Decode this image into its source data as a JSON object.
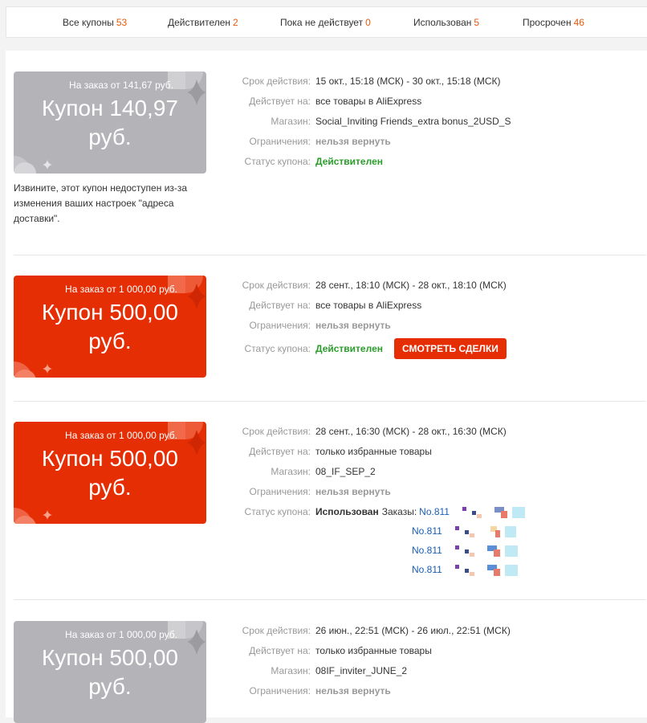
{
  "tabs": [
    {
      "label": "Все купоны",
      "count": "53"
    },
    {
      "label": "Действителен",
      "count": "2"
    },
    {
      "label": "Пока не действует",
      "count": "0"
    },
    {
      "label": "Использован",
      "count": "5"
    },
    {
      "label": "Просрочен",
      "count": "46"
    }
  ],
  "labels": {
    "period": "Срок действия:",
    "applies": "Действует на:",
    "store": "Магазин:",
    "limits": "Ограничения:",
    "status": "Статус купона:",
    "orders": "Заказы:"
  },
  "coupons": [
    {
      "style": "gray",
      "min_order": "На заказ от 141,67 руб.",
      "amount_line1": "Купон 140,97",
      "amount_line2": "руб.",
      "period": "15 окт., 15:18 (МСК) - 30 окт., 15:18 (МСК)",
      "applies": "все товары в AliExpress",
      "store": "Social_Inviting Friends_extra bonus_2USD_S",
      "limits": "нельзя вернуть",
      "status": "Действителен",
      "note": "Извините, этот купон недоступен из-за изменения ваших настроек \"адреса доставки\"."
    },
    {
      "style": "red",
      "min_order": "На заказ от 1 000,00 руб.",
      "amount_line1": "Купон 500,00",
      "amount_line2": "руб.",
      "period": "28 сент., 18:10 (МСК) - 28 окт., 18:10 (МСК)",
      "applies": "все товары в AliExpress",
      "limits": "нельзя вернуть",
      "status": "Действителен",
      "button": "СМОТРЕТЬ СДЕЛКИ"
    },
    {
      "style": "red",
      "min_order": "На заказ от 1 000,00 руб.",
      "amount_line1": "Купон 500,00",
      "amount_line2": "руб.",
      "period": "28 сент., 16:30 (МСК) - 28 окт., 16:30 (МСК)",
      "applies": "только избранные товары",
      "store": "08_IF_SEP_2",
      "limits": "нельзя вернуть",
      "status": "Использован",
      "orders": [
        "No.811",
        "No.811",
        "No.811",
        "No.811"
      ]
    },
    {
      "style": "gray",
      "min_order": "На заказ от 1 000,00 руб.",
      "amount_line1": "Купон 500,00",
      "amount_line2": "руб.",
      "period": "26 июн., 22:51 (МСК) - 26 июл., 22:51 (МСК)",
      "applies": "только избранные товары",
      "store": "08IF_inviter_JUNE_2",
      "limits": "нельзя вернуть"
    }
  ]
}
